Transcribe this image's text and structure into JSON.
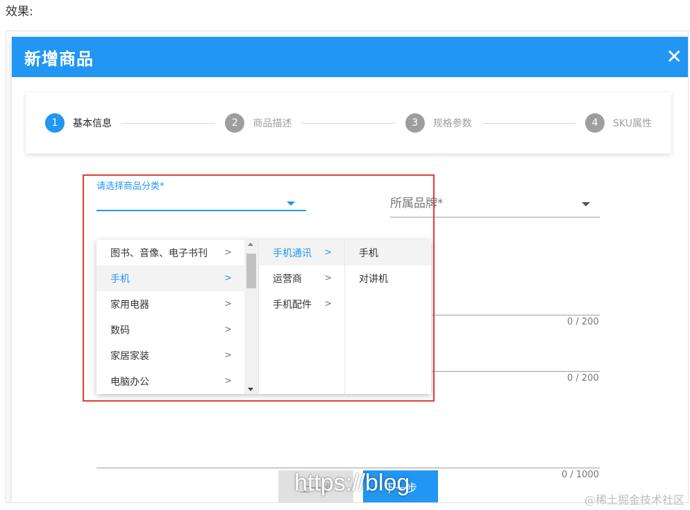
{
  "page_label": "效果:",
  "dialog": {
    "title": "新增商品",
    "close_glyph": "✕"
  },
  "steps": [
    {
      "num": "1",
      "label": "基本信息",
      "active": true
    },
    {
      "num": "2",
      "label": "商品描述",
      "active": false
    },
    {
      "num": "3",
      "label": "规格参数",
      "active": false
    },
    {
      "num": "4",
      "label": "SKU属性",
      "active": false
    }
  ],
  "form": {
    "category_label": "请选择商品分类*",
    "category_value": "",
    "brand_placeholder": "所属品牌*",
    "counter1": "0 / 200",
    "counter2": "0 / 200",
    "counter3": "0 / 1000"
  },
  "cascader": {
    "col1": [
      "图书、音像、电子书刊",
      "手机",
      "家用电器",
      "数码",
      "家居家装",
      "电脑办公"
    ],
    "col1_selected": 1,
    "col2": [
      "手机通讯",
      "运营商",
      "手机配件"
    ],
    "col2_selected": 0,
    "col3": [
      "手机",
      "对讲机"
    ],
    "col3_hover": 0,
    "chevron": ">"
  },
  "buttons": {
    "prev": "上一步",
    "next": "下一步"
  },
  "watermark": {
    "url": "https://blog",
    "site": "@稀土掘金技术社区"
  },
  "colors": {
    "primary": "#2196f3",
    "highlight_border": "#e53935"
  }
}
